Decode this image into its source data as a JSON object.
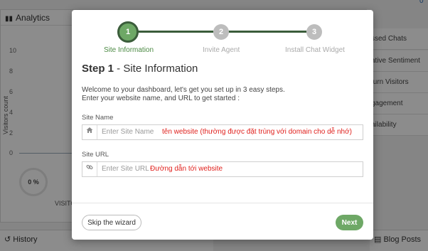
{
  "background": {
    "analytics_title": "Analytics",
    "y_ticks": [
      "10",
      "8",
      "6",
      "4",
      "2",
      "0"
    ],
    "y_axis_label": "Visitors count",
    "percent": "0 %",
    "visitors_label": "VISITO",
    "right_items": [
      "ssed Chats",
      "ative Sentiment",
      "turn Visitors",
      "gagement",
      "ailability"
    ],
    "history_label": "History",
    "blog_posts_label": "Blog Posts",
    "top_right_count": "0"
  },
  "wizard": {
    "steps": [
      {
        "number": "1",
        "label": "Site Information",
        "active": true
      },
      {
        "number": "2",
        "label": "Invite Agent",
        "active": false
      },
      {
        "number": "3",
        "label": "Install Chat Widget",
        "active": false
      }
    ],
    "title_bold": "Step 1",
    "title_rest": " - Site Information",
    "intro_line1": "Welcome to your dashboard, let's get you set up in 3 easy steps.",
    "intro_line2": "Enter your website name, and URL to get started :",
    "site_name": {
      "label": "Site Name",
      "placeholder": "Enter Site Name",
      "annotation": "tên website (thường được đặt trùng với domain cho dễ nhớ)",
      "icon": "home-icon"
    },
    "site_url": {
      "label": "Site URL",
      "placeholder": "Enter Site URL",
      "annotation": "Đường dẫn tới website",
      "icon": "link-icon"
    },
    "skip_label": "Skip the wizard",
    "next_label": "Next"
  },
  "colors": {
    "accent_green": "#6ea866",
    "dark_green": "#3b5d3b",
    "annotation_red": "#e0211d"
  }
}
